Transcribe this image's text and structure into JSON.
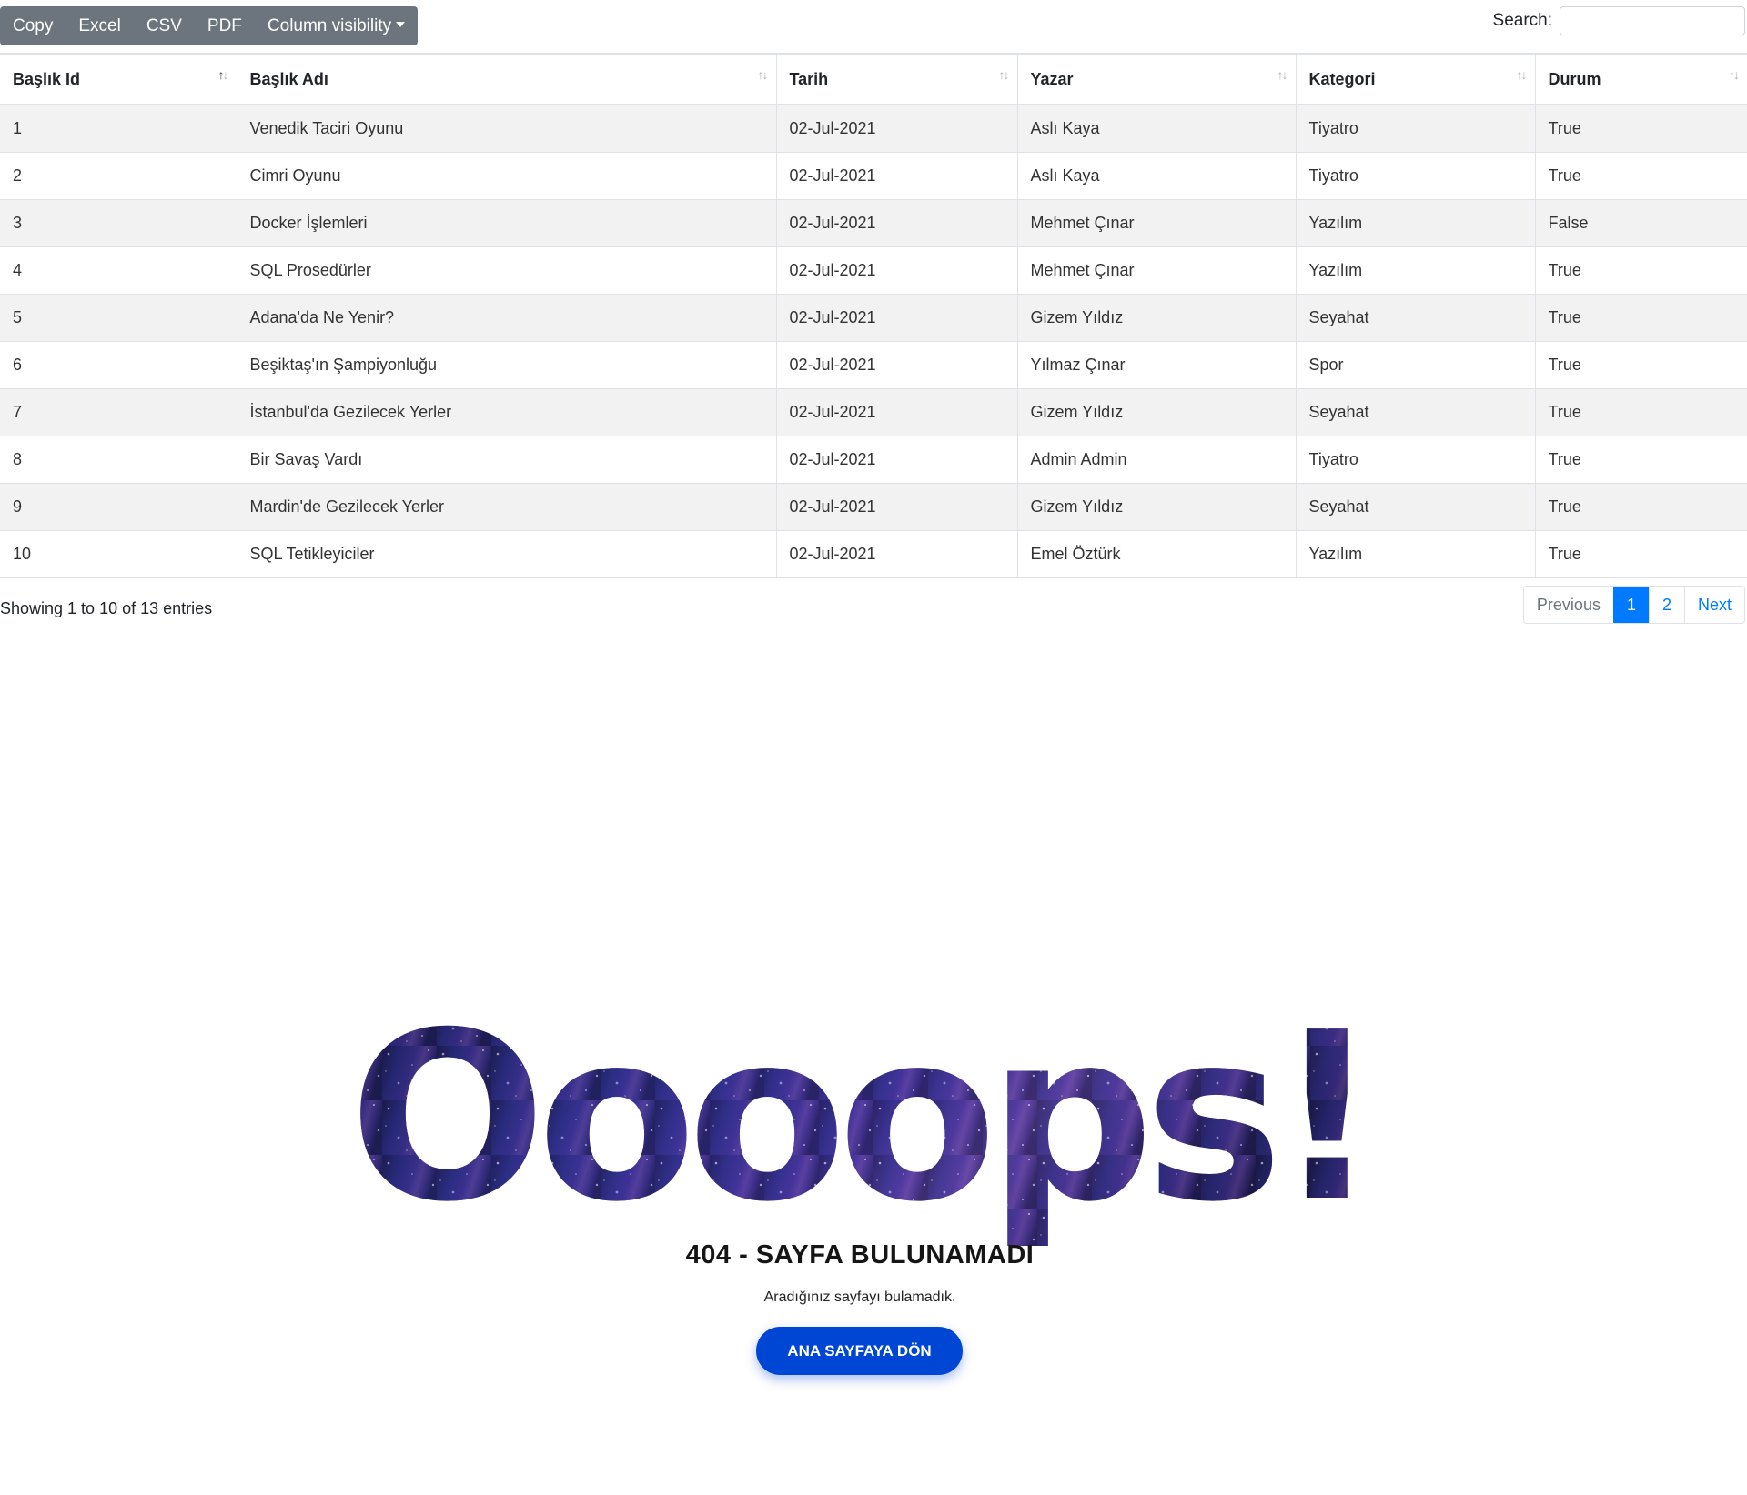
{
  "toolbar": {
    "buttons": [
      "Copy",
      "Excel",
      "CSV",
      "PDF",
      "Column visibility"
    ]
  },
  "search": {
    "label": "Search:",
    "value": "",
    "placeholder": ""
  },
  "table": {
    "columns": [
      "Başlık Id",
      "Başlık Adı",
      "Tarih",
      "Yazar",
      "Kategori",
      "Durum"
    ],
    "rows": [
      [
        "1",
        "Venedik Taciri Oyunu",
        "02-Jul-2021",
        "Aslı Kaya",
        "Tiyatro",
        "True"
      ],
      [
        "2",
        "Cimri Oyunu",
        "02-Jul-2021",
        "Aslı Kaya",
        "Tiyatro",
        "True"
      ],
      [
        "3",
        "Docker İşlemleri",
        "02-Jul-2021",
        "Mehmet Çınar",
        "Yazılım",
        "False"
      ],
      [
        "4",
        "SQL Prosedürler",
        "02-Jul-2021",
        "Mehmet Çınar",
        "Yazılım",
        "True"
      ],
      [
        "5",
        "Adana'da Ne Yenir?",
        "02-Jul-2021",
        "Gizem Yıldız",
        "Seyahat",
        "True"
      ],
      [
        "6",
        "Beşiktaş'ın Şampiyonluğu",
        "02-Jul-2021",
        "Yılmaz Çınar",
        "Spor",
        "True"
      ],
      [
        "7",
        "İstanbul'da Gezilecek Yerler",
        "02-Jul-2021",
        "Gizem Yıldız",
        "Seyahat",
        "True"
      ],
      [
        "8",
        "Bir Savaş Vardı",
        "02-Jul-2021",
        "Admin Admin",
        "Tiyatro",
        "True"
      ],
      [
        "9",
        "Mardin'de Gezilecek Yerler",
        "02-Jul-2021",
        "Gizem Yıldız",
        "Seyahat",
        "True"
      ],
      [
        "10",
        "SQL Tetikleyiciler",
        "02-Jul-2021",
        "Emel Öztürk",
        "Yazılım",
        "True"
      ]
    ]
  },
  "info": "Showing 1 to 10 of 13 entries",
  "pagination": {
    "previous": "Previous",
    "pages": [
      "1",
      "2"
    ],
    "active_page": "1",
    "next": "Next"
  },
  "error_page": {
    "headline": "Oooops!",
    "title": "404 - SAYFA BULUNAMADI",
    "message": "Aradığınız sayfayı bulamadık.",
    "button": "ANA SAYFAYA DÖN"
  },
  "colors": {
    "toolbar_bg": "#6c757d",
    "accent": "#007bff",
    "button_bg": "#0046d5",
    "galaxy_dark": "#1a1850",
    "galaxy_mid": "#3b2a8a",
    "galaxy_light": "#7b5bb5"
  },
  "icons": {
    "sort": "sort-arrows-icon",
    "dropdown": "caret-down-icon"
  }
}
